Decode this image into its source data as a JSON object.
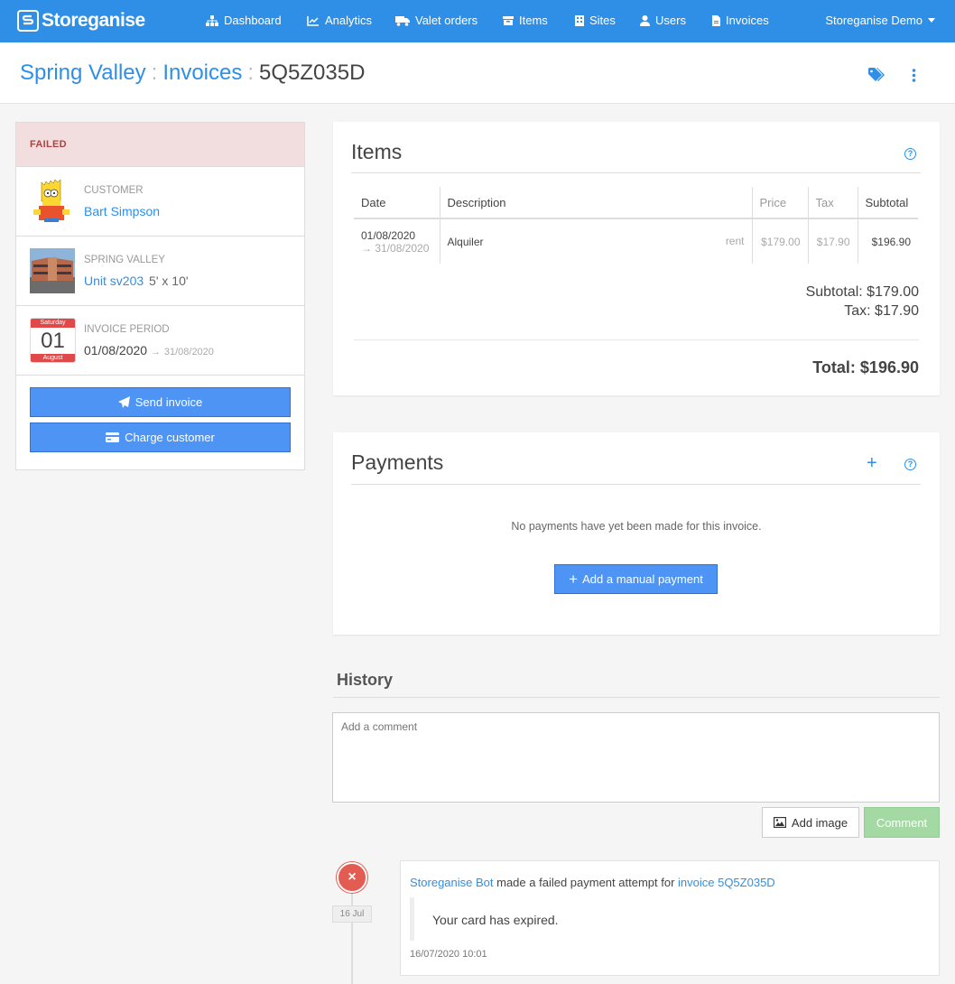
{
  "nav": {
    "brand": "Storeganise",
    "items": [
      {
        "label": "Dashboard",
        "icon": "sitemap-icon"
      },
      {
        "label": "Analytics",
        "icon": "line-chart-icon"
      },
      {
        "label": "Valet orders",
        "icon": "truck-icon"
      },
      {
        "label": "Items",
        "icon": "box-icon"
      },
      {
        "label": "Sites",
        "icon": "building-icon"
      },
      {
        "label": "Users",
        "icon": "user-icon"
      },
      {
        "label": "Invoices",
        "icon": "file-invoice-icon"
      }
    ],
    "account": "Storeganise Demo"
  },
  "header": {
    "crumb_site": "Spring Valley",
    "sep": ":",
    "crumb_invoices": "Invoices",
    "invoice_id": "5Q5Z035D"
  },
  "sidebar": {
    "status": "FAILED",
    "customer_label": "CUSTOMER",
    "customer_name": "Bart Simpson",
    "site_label": "SPRING VALLEY",
    "unit_link": "Unit sv203",
    "unit_size": "5' x 10'",
    "calendar_weekday": "Saturday",
    "calendar_day": "01",
    "calendar_month": "August",
    "period_label": "INVOICE PERIOD",
    "period_start": "01/08/2020",
    "period_arrow": "→",
    "period_end": "31/08/2020",
    "send_invoice": "Send invoice",
    "charge_customer": "Charge customer"
  },
  "items_panel": {
    "title": "Items",
    "help": "?",
    "columns": {
      "date": "Date",
      "description": "Description",
      "price": "Price",
      "tax": "Tax",
      "subtotal": "Subtotal"
    },
    "rows": [
      {
        "date_start": "01/08/2020",
        "date_end": "→ 31/08/2020",
        "description": "Alquiler",
        "type": "rent",
        "price": "$179.00",
        "tax": "$17.90",
        "subtotal": "$196.90"
      }
    ],
    "subtotal": "Subtotal: $179.00",
    "tax": "Tax: $17.90",
    "total": "Total: $196.90"
  },
  "payments_panel": {
    "title": "Payments",
    "add_icon": "+",
    "help": "?",
    "empty_text": "No payments have yet been made for this invoice.",
    "add_button": "Add a manual payment"
  },
  "history": {
    "title": "History",
    "comment_placeholder": "Add a comment",
    "add_image": "Add image",
    "comment_button": "Comment",
    "events": [
      {
        "badge": "×",
        "date": "16 Jul",
        "actor": "Storeganise Bot",
        "action": " made a failed payment attempt for ",
        "target": "invoice 5Q5Z035D",
        "message": "Your card has expired.",
        "timestamp": "16/07/2020 10:01"
      }
    ]
  },
  "colors": {
    "primary": "#2f8fe6",
    "button": "#4d94f5",
    "danger": "#e25c52",
    "status_bg": "#f2dede",
    "comment_green": "#a4d9a4"
  }
}
